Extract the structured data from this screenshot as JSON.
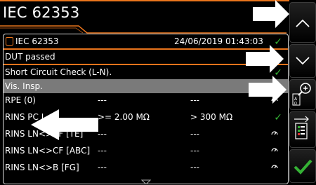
{
  "header": {
    "title": "IEC 62353"
  },
  "panel": {
    "rows": [
      {
        "label": "IEC 62353",
        "date": "24/06/2019 01:43:03",
        "status": "check"
      },
      {
        "label": "DUT passed"
      },
      {
        "label": "Short Circuit Check (L-N).",
        "status": "check"
      },
      {
        "label": "Vis. Insp.",
        "selected": true
      },
      {
        "label": "RPE (0)",
        "limit": "---",
        "value": "---",
        "status": "gauge"
      },
      {
        "label": "RINS PC I",
        "limit": ">= 2.00 MΩ",
        "value": "> 300 MΩ",
        "status": "check"
      },
      {
        "label": "RINS LN<>BF [TE]",
        "limit": "---",
        "value": "---",
        "status": "gauge"
      },
      {
        "label": "RINS LN<>CF [ABC]",
        "limit": "---",
        "value": "---",
        "status": "gauge"
      },
      {
        "label": "RINS LN<>B [FG]",
        "limit": "---",
        "value": "---",
        "status": "gauge"
      }
    ]
  },
  "sidebar": {
    "buttons": [
      "up-button",
      "down-button",
      "zoom-button",
      "report-button",
      "confirm-button"
    ]
  },
  "colors": {
    "accent": "#e8741c",
    "pass": "#35b235",
    "selected_row": "#7a7a7a"
  }
}
